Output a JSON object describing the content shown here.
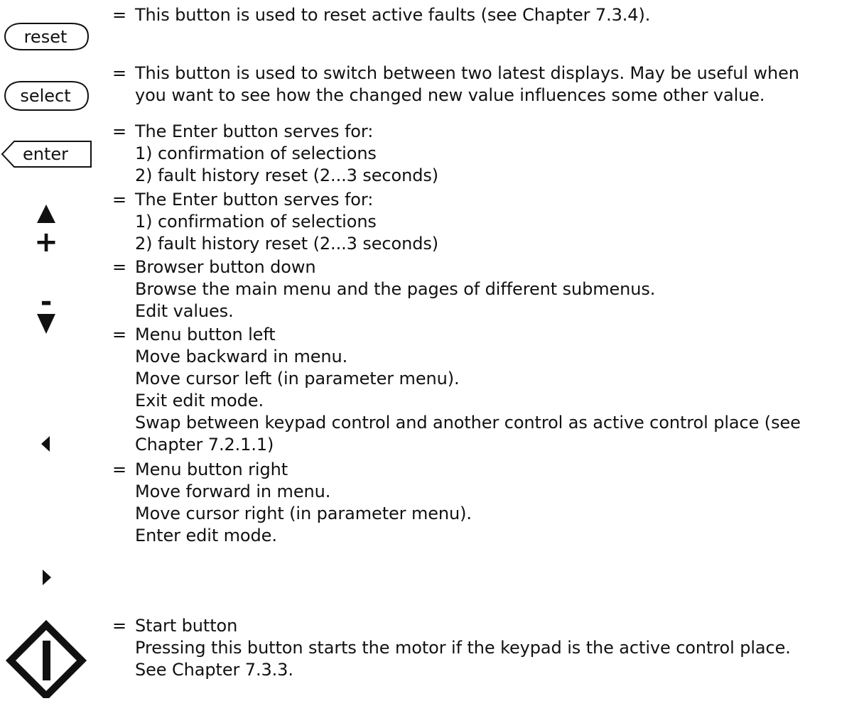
{
  "rows": [
    {
      "icon": "reset-button-icon",
      "icon_label": "reset",
      "eq": "=",
      "lines": [
        "This button is used to reset active faults (see Chapter 7.3.4)."
      ]
    },
    {
      "icon": "select-button-icon",
      "icon_label": "select",
      "eq": "=",
      "lines": [
        "This button is used to switch between two latest displays. May be useful when",
        "you want to see how the changed new value influences some other value."
      ]
    },
    {
      "icon": "enter-button-icon",
      "icon_label": "enter",
      "eq": "=",
      "lines": [
        "The Enter button serves for:",
        "1) confirmation of selections",
        "2) fault history reset (2...3 seconds)"
      ]
    },
    {
      "icon": "up-plus-arrow-icon",
      "icon_label": "+",
      "eq": "=",
      "lines": [
        "The Enter button serves for:",
        "1) confirmation of selections",
        "2) fault history reset (2...3 seconds)"
      ]
    },
    {
      "icon": "down-minus-arrow-icon",
      "icon_label": "-",
      "eq": "=",
      "lines": [
        "Browser button down",
        "Browse the main menu and the pages of different submenus.",
        "Edit values."
      ]
    },
    {
      "icon": "left-arrow-icon",
      "eq": "=",
      "lines": [
        "Menu button left",
        "Move backward in menu.",
        "Move cursor left (in parameter menu).",
        "Exit edit mode.",
        "Swap between keypad control and another control as active control place (see",
        "Chapter 7.2.1.1)"
      ]
    },
    {
      "icon": "right-arrow-icon",
      "eq": "=",
      "lines": [
        "Menu button right",
        "Move forward in menu.",
        "Move cursor right (in parameter menu).",
        "Enter edit mode."
      ]
    },
    {
      "icon": "start-button-icon",
      "eq": "=",
      "lines": [
        "Start button",
        "Pressing this button starts the motor if the keypad is the active control place.",
        "See Chapter 7.3.3."
      ]
    }
  ]
}
